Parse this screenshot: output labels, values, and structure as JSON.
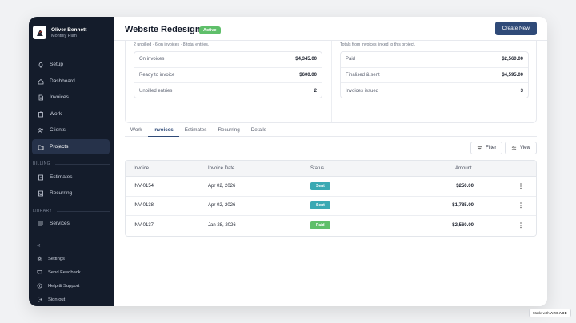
{
  "user": {
    "name": "Oliver Bennett",
    "plan": "Monthly Plan"
  },
  "sidebar": {
    "main_items": [
      {
        "label": "Setup",
        "icon": "rocket-icon"
      },
      {
        "label": "Dashboard",
        "icon": "home-icon"
      },
      {
        "label": "Invoices",
        "icon": "document-icon"
      },
      {
        "label": "Work",
        "icon": "clipboard-icon"
      },
      {
        "label": "Clients",
        "icon": "users-icon"
      },
      {
        "label": "Projects",
        "icon": "folder-icon",
        "active": true
      }
    ],
    "billing_label": "BILLING",
    "billing_items": [
      {
        "label": "Estimates",
        "icon": "estimate-icon"
      },
      {
        "label": "Recurring",
        "icon": "recurring-icon"
      }
    ],
    "library_label": "LIBRARY",
    "library_items": [
      {
        "label": "Services",
        "icon": "list-icon"
      }
    ],
    "collapse": "«",
    "footer_items": [
      {
        "label": "Settings",
        "icon": "gear-icon"
      },
      {
        "label": "Send Feedback",
        "icon": "message-icon"
      },
      {
        "label": "Help & Support",
        "icon": "help-icon"
      },
      {
        "label": "Sign out",
        "icon": "signout-icon"
      }
    ]
  },
  "header": {
    "title": "Website Redesign",
    "status_badge": "Active",
    "create_button": "Create New"
  },
  "summary": {
    "left_subtext": "2 unbilled · 6 on invoices · 8 total entries.",
    "right_subtext": "Totals from invoices linked to this project.",
    "left_rows": [
      {
        "label": "On invoices",
        "value": "$4,345.00"
      },
      {
        "label": "Ready to invoice",
        "value": "$600.00"
      },
      {
        "label": "Unbilled entries",
        "value": "2"
      }
    ],
    "right_rows": [
      {
        "label": "Paid",
        "value": "$2,560.00"
      },
      {
        "label": "Finalised & sent",
        "value": "$4,595.00"
      },
      {
        "label": "Invoices issued",
        "value": "3"
      }
    ]
  },
  "tabs": [
    {
      "label": "Work"
    },
    {
      "label": "Invoices",
      "active": true
    },
    {
      "label": "Estimates"
    },
    {
      "label": "Recurring"
    },
    {
      "label": "Details"
    }
  ],
  "toolbar": {
    "filter": "Filter",
    "view": "View"
  },
  "table": {
    "columns": [
      "Invoice",
      "Invoice Date",
      "Status",
      "Amount"
    ],
    "rows": [
      {
        "invoice": "INV-0154",
        "date": "Apr 02, 2026",
        "status": "Sent",
        "status_color": "#3aa9b3",
        "amount": "$250.00"
      },
      {
        "invoice": "INV-0138",
        "date": "Apr 02, 2026",
        "status": "Sent",
        "status_color": "#3aa9b3",
        "amount": "$1,785.00"
      },
      {
        "invoice": "INV-0137",
        "date": "Jan 28, 2026",
        "status": "Paid",
        "status_color": "#5fbf6a",
        "amount": "$2,560.00"
      }
    ]
  },
  "watermark": {
    "prefix": "Made with",
    "brand": "ARCADE"
  },
  "colors": {
    "sidebar_bg": "#141c2b",
    "accent": "#2f4a78",
    "active_badge": "#5fbf6a",
    "sent_badge": "#3aa9b3"
  }
}
